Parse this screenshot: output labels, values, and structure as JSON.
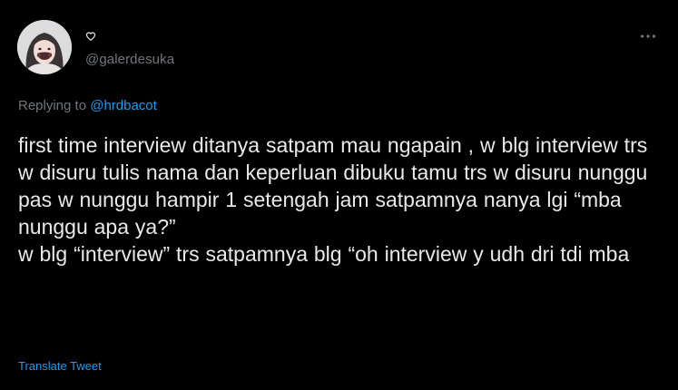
{
  "tweet": {
    "display_name_icon": "heart-icon",
    "handle": "@galerdesuka",
    "more_icon": "more-horizontal-icon",
    "replying_prefix": "Replying to",
    "replying_to": "@hrdbacot",
    "text": "first time interview ditanya satpam mau ngapain , w blg interview trs w disuru tulis nama dan keperluan dibuku tamu trs w disuru nunggu pas w nunggu hampir 1 setengah jam satpamnya nanya lgi “mba nunggu apa ya?”\nw blg “interview” trs satpamnya blg “oh interview y udh dri tdi mba",
    "translate_label": "Translate Tweet"
  },
  "colors": {
    "background": "#000000",
    "text_primary": "#e7e9ea",
    "text_secondary": "#71767b",
    "link": "#1d9bf0"
  }
}
